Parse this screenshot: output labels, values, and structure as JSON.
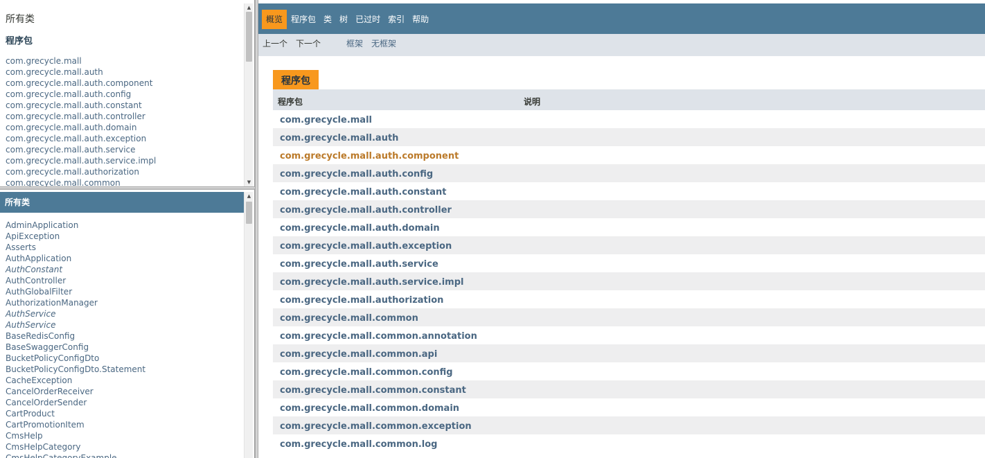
{
  "left_top": {
    "title": "所有类",
    "subtitle": "程序包",
    "packages": [
      "com.grecycle.mall",
      "com.grecycle.mall.auth",
      "com.grecycle.mall.auth.component",
      "com.grecycle.mall.auth.config",
      "com.grecycle.mall.auth.constant",
      "com.grecycle.mall.auth.controller",
      "com.grecycle.mall.auth.domain",
      "com.grecycle.mall.auth.exception",
      "com.grecycle.mall.auth.service",
      "com.grecycle.mall.auth.service.impl",
      "com.grecycle.mall.authorization",
      "com.grecycle.mall.common"
    ]
  },
  "left_bottom": {
    "header": "所有类",
    "classes": [
      {
        "name": "AdminApplication",
        "interface": false
      },
      {
        "name": "ApiException",
        "interface": false
      },
      {
        "name": "Asserts",
        "interface": false
      },
      {
        "name": "AuthApplication",
        "interface": false
      },
      {
        "name": "AuthConstant",
        "interface": true
      },
      {
        "name": "AuthController",
        "interface": false
      },
      {
        "name": "AuthGlobalFilter",
        "interface": false
      },
      {
        "name": "AuthorizationManager",
        "interface": false
      },
      {
        "name": "AuthService",
        "interface": true
      },
      {
        "name": "AuthService",
        "interface": true
      },
      {
        "name": "BaseRedisConfig",
        "interface": false
      },
      {
        "name": "BaseSwaggerConfig",
        "interface": false
      },
      {
        "name": "BucketPolicyConfigDto",
        "interface": false
      },
      {
        "name": "BucketPolicyConfigDto.Statement",
        "interface": false
      },
      {
        "name": "CacheException",
        "interface": false
      },
      {
        "name": "CancelOrderReceiver",
        "interface": false
      },
      {
        "name": "CancelOrderSender",
        "interface": false
      },
      {
        "name": "CartProduct",
        "interface": false
      },
      {
        "name": "CartPromotionItem",
        "interface": false
      },
      {
        "name": "CmsHelp",
        "interface": false
      },
      {
        "name": "CmsHelpCategory",
        "interface": false
      },
      {
        "name": "CmsHelpCategoryExample",
        "interface": false
      }
    ]
  },
  "topnav": {
    "items": [
      "概览",
      "程序包",
      "类",
      "树",
      "已过时",
      "索引",
      "帮助"
    ],
    "active_index": 0
  },
  "subnav": {
    "prev": "上一个",
    "next": "下一个",
    "frames": "框架",
    "no_frames": "无框架"
  },
  "overview": {
    "caption": "程序包",
    "col_package": "程序包",
    "col_description": "说明",
    "hover_index": 2,
    "packages": [
      "com.grecycle.mall",
      "com.grecycle.mall.auth",
      "com.grecycle.mall.auth.component",
      "com.grecycle.mall.auth.config",
      "com.grecycle.mall.auth.constant",
      "com.grecycle.mall.auth.controller",
      "com.grecycle.mall.auth.domain",
      "com.grecycle.mall.auth.exception",
      "com.grecycle.mall.auth.service",
      "com.grecycle.mall.auth.service.impl",
      "com.grecycle.mall.authorization",
      "com.grecycle.mall.common",
      "com.grecycle.mall.common.annotation",
      "com.grecycle.mall.common.api",
      "com.grecycle.mall.common.config",
      "com.grecycle.mall.common.constant",
      "com.grecycle.mall.common.domain",
      "com.grecycle.mall.common.exception",
      "com.grecycle.mall.common.log"
    ]
  },
  "colors": {
    "nav_bar": "#4d7a97",
    "nav_active": "#f8981d",
    "link": "#4a6782",
    "link_hover": "#bb7a2a",
    "row_alt": "#eeeeef",
    "subnav_bg": "#dee3e9"
  }
}
